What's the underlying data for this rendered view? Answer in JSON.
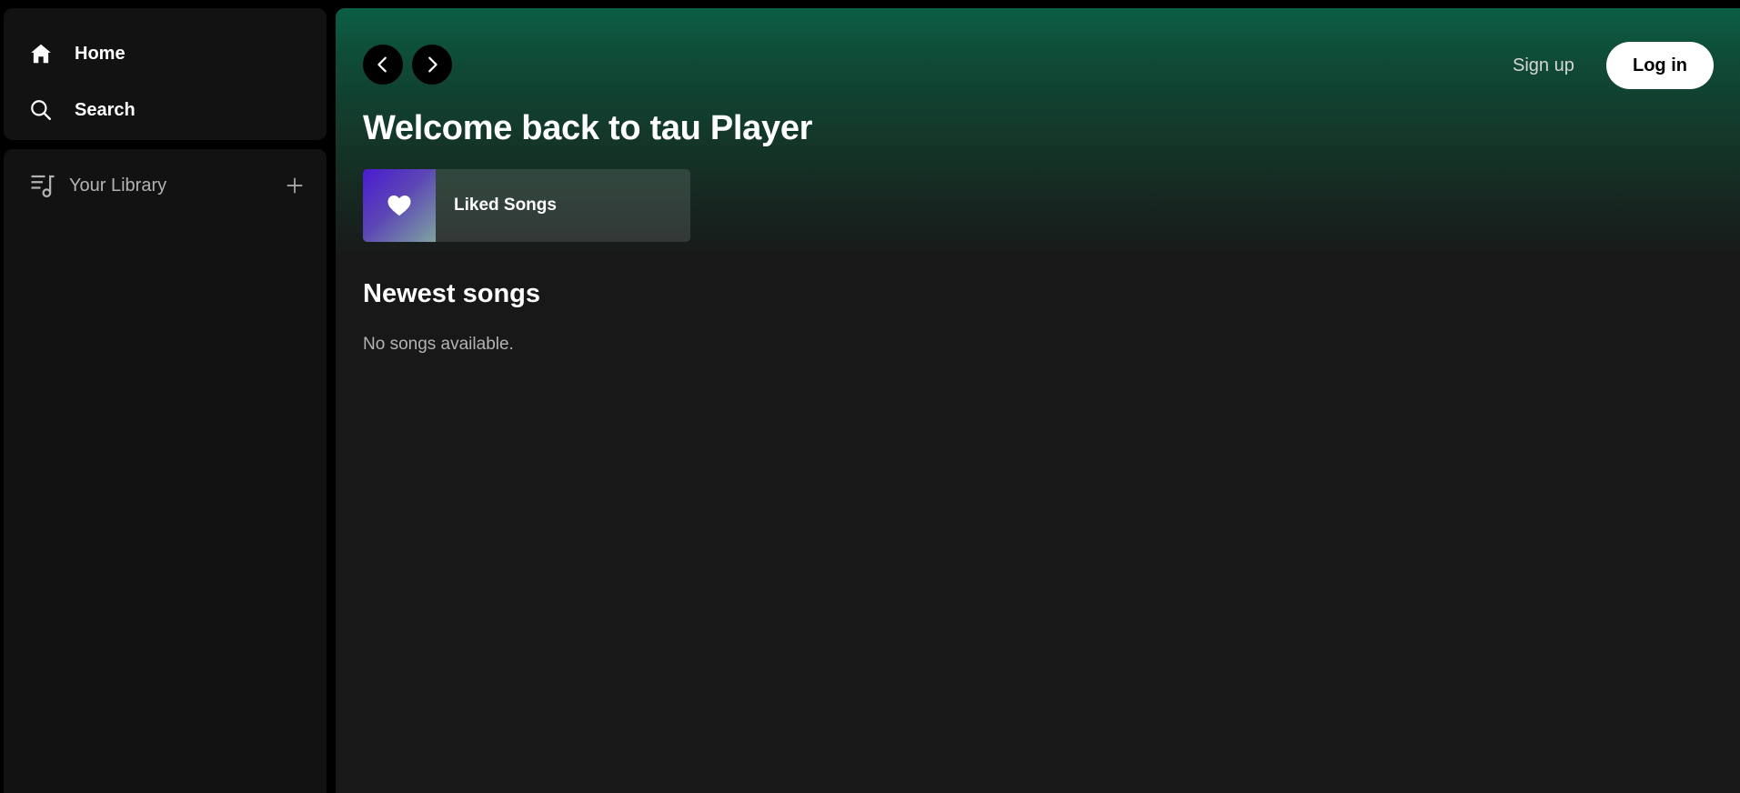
{
  "sidebar": {
    "nav": [
      {
        "label": "Home",
        "icon": "home-icon"
      },
      {
        "label": "Search",
        "icon": "search-icon"
      }
    ],
    "library": {
      "label": "Your Library",
      "icon": "library-icon",
      "add_icon": "plus-icon"
    }
  },
  "header": {
    "back_icon": "chevron-left-icon",
    "forward_icon": "chevron-right-icon",
    "signup_label": "Sign up",
    "login_label": "Log in"
  },
  "main": {
    "welcome": "Welcome back to tau Player",
    "liked_songs": {
      "label": "Liked Songs",
      "icon": "heart-icon"
    },
    "newest_title": "Newest songs",
    "empty_message": "No songs available."
  },
  "colors": {
    "accent_green": "#0c5e45",
    "panel": "#121212",
    "main_bg": "#181818",
    "muted_text": "#b3b3b3"
  }
}
